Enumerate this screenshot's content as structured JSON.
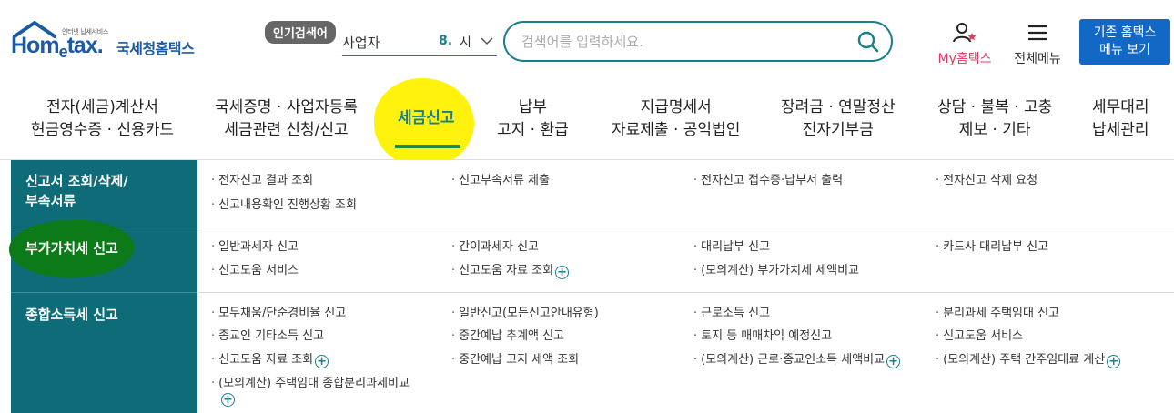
{
  "header": {
    "logo_small_text": "인터넷 납세서비스",
    "logo_home_pre": "Hom",
    "logo_home_e": "e",
    "logo_home_post": "tax.",
    "logo_korean": "국세청홈택스",
    "popular_search_badge": "인기검색어",
    "popular_rank_word": "사업자",
    "popular_rank_number": "8.",
    "popular_rank_time": "시",
    "search_placeholder": "검색어를 입력하세요.",
    "my_hometax_label": "My홈택스",
    "all_menu_label": "전체메뉴",
    "legacy_button_line1": "기존 홈택스",
    "legacy_button_line2": "메뉴 보기"
  },
  "gnb": [
    {
      "line1": "전자(세금)계산서",
      "line2": "현금영수증 · 신용카드"
    },
    {
      "line1": "국세증명 · 사업자등록",
      "line2": "세금관련 신청/신고"
    },
    {
      "line1": "세금신고",
      "line2": "",
      "active": true
    },
    {
      "line1": "납부",
      "line2": "고지 · 환급"
    },
    {
      "line1": "지급명세서",
      "line2": "자료제출 · 공익법인"
    },
    {
      "line1": "장려금 · 연말정산",
      "line2": "전자기부금"
    },
    {
      "line1": "상담 · 불복 · 고충",
      "line2": "제보 · 기타"
    },
    {
      "line1": "세무대리",
      "line2": "납세관리"
    }
  ],
  "sections": [
    {
      "title_line1": "신고서 조회/삭제/",
      "title_line2": "부속서류",
      "links": [
        "전자신고 결과 조회",
        "신고부속서류 제출",
        "전자신고 접수증·납부서 출력",
        "전자신고 삭제 요청",
        "신고내용확인 진행상황 조회"
      ]
    },
    {
      "title_line1": "부가가치세 신고",
      "links": [
        "일반과세자 신고",
        "간이과세자 신고",
        "대리납부 신고",
        "카드사 대리납부 신고",
        "신고도움 서비스",
        "신고도움 자료 조회",
        "(모의계산) 부가가치세 세액비교"
      ]
    },
    {
      "title_line1": "종합소득세 신고",
      "links": [
        "모두채움/단순경비율 신고",
        "일반신고(모든신고안내유형)",
        "근로소득 신고",
        "분리과세 주택임대 신고",
        "종교인 기타소득 신고",
        "중간예납 추계액 신고",
        "토지 등 매매차익 예정신고",
        "신고도움 서비스",
        "신고도움 자료 조회",
        "중간예납 고지 세액 조회",
        "(모의계산) 근로·종교인소득 세액비교",
        "(모의계산) 주택 간주임대료 계산",
        "(모의계산) 주택임대 종합분리과세비교"
      ]
    }
  ],
  "colors": {
    "brand_blue": "#1a5aa6",
    "teal": "#1a7f8c",
    "sidebar_teal": "#0e6c78",
    "button_blue": "#1268c4",
    "highlight_yellow": "#fff200",
    "highlight_green": "#0c7a18",
    "my_hometax_pink": "#e03a5c"
  },
  "icons": {
    "search": "search-icon",
    "user": "user-star-icon",
    "menu": "hamburger-icon",
    "expand": "plus-circle-icon",
    "dropdown": "chevron-down-icon"
  }
}
